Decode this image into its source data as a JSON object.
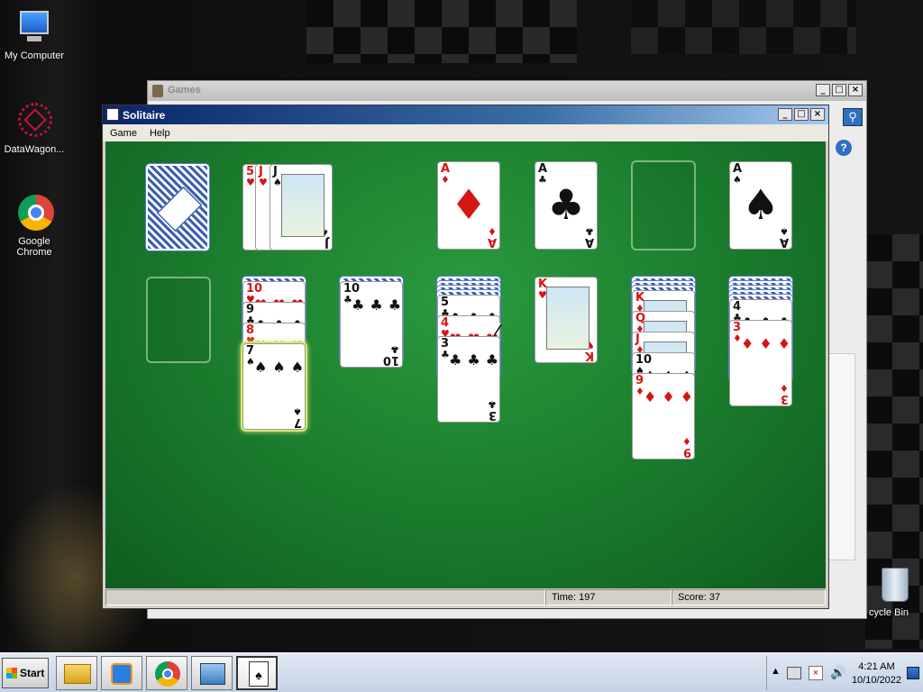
{
  "desktop": {
    "icons": [
      {
        "label": "My Computer"
      },
      {
        "label": "DataWagon..."
      },
      {
        "label": "Google Chrome"
      },
      {
        "label": "cycle Bin"
      }
    ]
  },
  "games_window": {
    "title": "Games",
    "controls": {
      "minimize": "_",
      "maximize": "□",
      "close": "×"
    }
  },
  "solitaire_window": {
    "title": "Solitaire",
    "controls": {
      "minimize": "_",
      "maximize": "□",
      "close": "×"
    },
    "menu": [
      "Game",
      "Help"
    ],
    "status": {
      "time_text": "Time:  197",
      "score_text": "Score: 37"
    }
  },
  "board": {
    "stock": {
      "state": "face-down"
    },
    "waste": [
      {
        "rank": "5",
        "suit": "♥",
        "color": "red"
      },
      {
        "rank": "J",
        "suit": "♥",
        "color": "red"
      },
      {
        "rank": "J",
        "suit": "♠",
        "color": "black"
      }
    ],
    "foundations": [
      {
        "rank": "A",
        "suit": "♦",
        "color": "red"
      },
      {
        "rank": "A",
        "suit": "♣",
        "color": "black"
      },
      {
        "rank": "",
        "suit": "",
        "color": "empty"
      },
      {
        "rank": "A",
        "suit": "♠",
        "color": "black"
      }
    ],
    "tableau": [
      {
        "hidden": 0,
        "cards": []
      },
      {
        "hidden": 1,
        "cards": [
          {
            "rank": "10",
            "suit": "♥",
            "color": "red"
          },
          {
            "rank": "9",
            "suit": "♣",
            "color": "black"
          },
          {
            "rank": "8",
            "suit": "♥",
            "color": "red"
          },
          {
            "rank": "7",
            "suit": "♠",
            "color": "black"
          }
        ]
      },
      {
        "hidden": 1,
        "cards": [
          {
            "rank": "10",
            "suit": "♣",
            "color": "black"
          }
        ]
      },
      {
        "hidden": 4,
        "cards": [
          {
            "rank": "5",
            "suit": "♣",
            "color": "black"
          },
          {
            "rank": "4",
            "suit": "♥",
            "color": "red"
          },
          {
            "rank": "3",
            "suit": "♣",
            "color": "black"
          }
        ]
      },
      {
        "hidden": 0,
        "cards": [
          {
            "rank": "K",
            "suit": "♥",
            "color": "red"
          }
        ]
      },
      {
        "hidden": 3,
        "cards": [
          {
            "rank": "K",
            "suit": "♦",
            "color": "red"
          },
          {
            "rank": "Q",
            "suit": "♦",
            "color": "red"
          },
          {
            "rank": "J",
            "suit": "♦",
            "color": "red"
          },
          {
            "rank": "10",
            "suit": "♠",
            "color": "black"
          },
          {
            "rank": "9",
            "suit": "♦",
            "color": "red"
          }
        ]
      },
      {
        "hidden": 5,
        "cards": [
          {
            "rank": "4",
            "suit": "♣",
            "color": "black"
          },
          {
            "rank": "3",
            "suit": "♦",
            "color": "red"
          }
        ]
      }
    ]
  },
  "taskbar": {
    "start_label": "Start",
    "apps": [
      "folder-icon",
      "media-player-icon",
      "chrome-icon",
      "control-panel-icon",
      "solitaire-icon"
    ],
    "clock_time": "4:21 AM",
    "clock_date": "10/10/2022"
  },
  "colors": {
    "felt": "#1a7a2c",
    "title_active": "#0a246a",
    "card_red": "#d51414"
  }
}
